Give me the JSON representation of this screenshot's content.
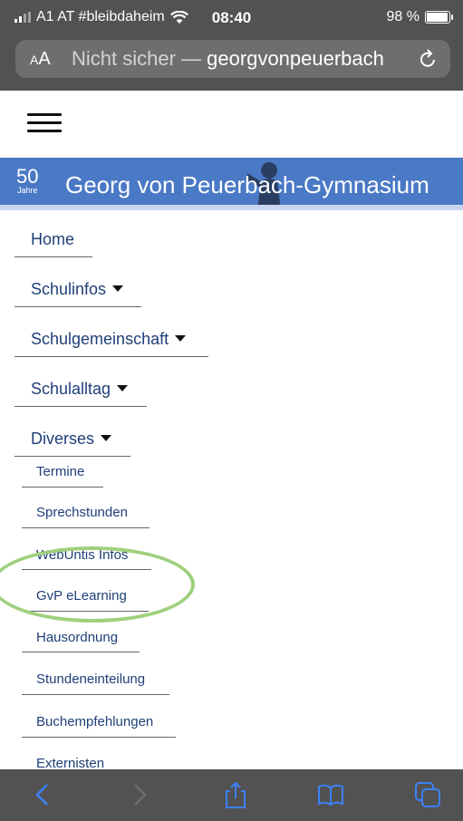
{
  "status_bar": {
    "carrier": "A1 AT #bleibdaheim",
    "time": "08:40",
    "battery": "98 %",
    "battery_level": 0.98
  },
  "browser": {
    "text_size_label": "AA",
    "security_label": "Nicht sicher —",
    "domain": "georgvonpeuerbach"
  },
  "banner": {
    "anniversary_number": "50",
    "anniversary_word": "Jahre",
    "title": "Georg von Peuerbach-Gymnasium"
  },
  "menu": {
    "items": [
      {
        "label": "Home"
      },
      {
        "label": "Schulinfos"
      },
      {
        "label": "Schulgemeinschaft"
      },
      {
        "label": "Schulalltag"
      },
      {
        "label": "Diverses"
      }
    ],
    "submenu": [
      {
        "label": "Termine"
      },
      {
        "label": "Sprechstunden"
      },
      {
        "label": "WebUntis Infos"
      },
      {
        "label": "GvP eLearning"
      },
      {
        "label": "Hausordnung"
      },
      {
        "label": "Stundeneinteilung"
      },
      {
        "label": "Buchempfehlungen"
      },
      {
        "label": "Externisten"
      }
    ]
  },
  "colors": {
    "accent_blue": "#4a79c6",
    "link_text": "#1f3f78",
    "ios_blue": "#3b82f6",
    "highlight_green": "#9fd07d"
  }
}
